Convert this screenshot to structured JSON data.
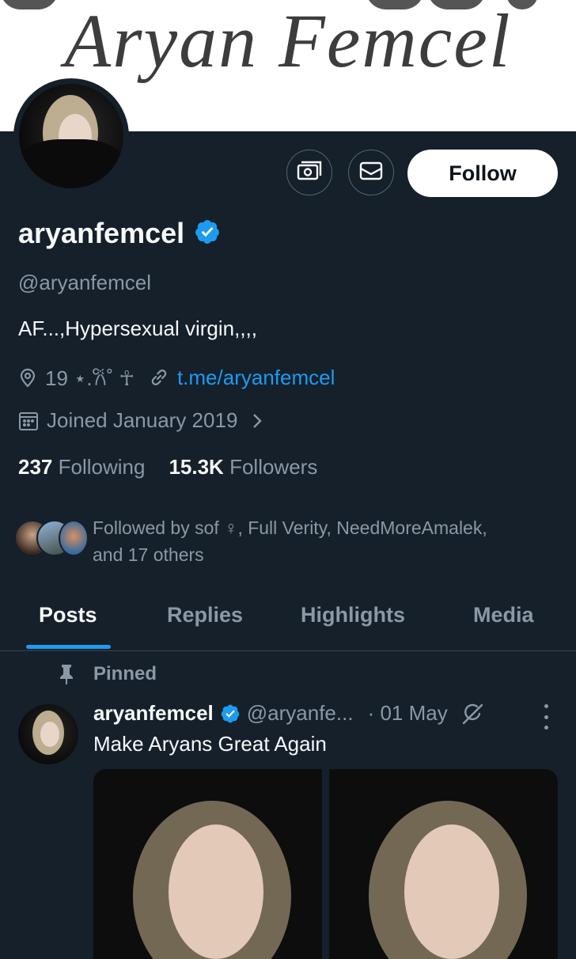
{
  "banner": {
    "title": "Aryan Femcel"
  },
  "profile": {
    "display_name": "aryanfemcel",
    "handle": "@aryanfemcel",
    "bio": "AF...,Hypersexual virgin,,,,",
    "location": "19 ⋆.𐙚˚ ☥",
    "link": "t.me/aryanfemcel",
    "joined": "Joined January 2019",
    "following_count": "237",
    "following_label": "Following",
    "followers_count": "15.3K",
    "followers_label": "Followers",
    "followed_by_line1": "Followed by sof ♀, Full Verity, NeedMoreAmalek,",
    "followed_by_line2": "and 17 others"
  },
  "actions": {
    "follow_label": "Follow",
    "tip_icon": "money-icon",
    "message_icon": "mail-icon"
  },
  "tabs": [
    {
      "label": "Posts",
      "active": true
    },
    {
      "label": "Replies",
      "active": false
    },
    {
      "label": "Highlights",
      "active": false
    },
    {
      "label": "Media",
      "active": false
    }
  ],
  "pinned_tweet": {
    "pinned_label": "Pinned",
    "name": "aryanfemcel",
    "handle": "@aryanfe...",
    "date": "· 01 May",
    "text": "Make Aryans Great Again"
  },
  "colors": {
    "background": "#15202b",
    "accent": "#1d9bf0",
    "secondary_text": "#8b98a5"
  }
}
